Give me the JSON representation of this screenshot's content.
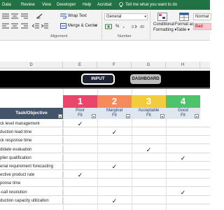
{
  "ribbon_tabs": [
    "Data",
    "Review",
    "View",
    "Developer",
    "Help",
    "Acrobat"
  ],
  "tell_me": "Tell me what you want to do",
  "ribbon": {
    "wrap_text": "Wrap Text",
    "merge_center": "Merge & Center",
    "alignment_group": "Alignment",
    "number_format": "General",
    "number_group": "Number",
    "percent_symbol": "%",
    "comma_symbol": ",",
    "conditional_formatting": [
      "Conditional",
      "Formatting ▾"
    ],
    "format_as_table": [
      "Format as",
      "Table ▾"
    ],
    "style_normal": "Normal",
    "style_bad": "Bad",
    "colors": {
      "tab_bar": "#217346",
      "bad_fill": "#ffc7ce",
      "bad_text": "#9c0006"
    }
  },
  "column_headers": [
    "D",
    "E",
    "F",
    "G",
    "H"
  ],
  "buttons": {
    "input": "INPUT",
    "dashboard": "DASHBOARD"
  },
  "task_header": "Task/Objective",
  "fit_levels": [
    {
      "number": "1",
      "label_top": "Poor",
      "label_bottom": "Fit",
      "color": "#e8476b"
    },
    {
      "number": "2",
      "label_top": "Marginal",
      "label_bottom": "Fit",
      "color": "#f58a5a"
    },
    {
      "number": "3",
      "label_top": "Acceptable",
      "label_bottom": "Fit",
      "color": "#f2cc3f"
    },
    {
      "number": "4",
      "label_top": "Good",
      "label_bottom": "Fit",
      "color": "#4fc36b"
    }
  ],
  "filter_glyph": "▾",
  "check_glyph": "✓",
  "rows": [
    {
      "task": "ck level management",
      "fit": 1
    },
    {
      "task": "duction lead time",
      "fit": 2
    },
    {
      "task": "ck response time",
      "fit": 0
    },
    {
      "task": "didate evaluation",
      "fit": 3
    },
    {
      "task": "plier qualification",
      "fit": 4
    },
    {
      "task": "erial requirement forecasting",
      "fit": 2
    },
    {
      "task": "ective product rate",
      "fit": 1
    },
    {
      "task": "ponse time",
      "fit": 0
    },
    {
      "task": "-call resolution",
      "fit": 4
    },
    {
      "task": "duction capacity utilization",
      "fit": 2
    }
  ]
}
